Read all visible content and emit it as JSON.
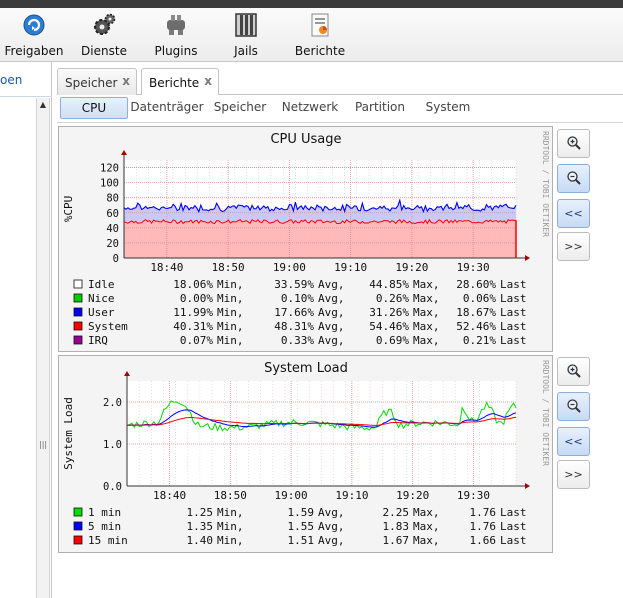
{
  "toolbar": {
    "items": [
      {
        "label": "Freigaben",
        "icon": "share-icon"
      },
      {
        "label": "Dienste",
        "icon": "gears-icon"
      },
      {
        "label": "Plugins",
        "icon": "plugin-icon"
      },
      {
        "label": "Jails",
        "icon": "jail-bars-icon"
      },
      {
        "label": "Berichte",
        "icon": "report-icon"
      }
    ]
  },
  "left_panel": {
    "link_fragment": "oen"
  },
  "tabs": [
    {
      "label": "Speicher",
      "close": "x",
      "active": false
    },
    {
      "label": "Berichte",
      "close": "x",
      "active": true
    }
  ],
  "subtabs": [
    {
      "label": "CPU",
      "active": true
    },
    {
      "label": "Datenträger",
      "active": false
    },
    {
      "label": "Speicher",
      "active": false
    },
    {
      "label": "Netzwerk",
      "active": false
    },
    {
      "label": "Partition",
      "active": false
    },
    {
      "label": "System",
      "active": false
    }
  ],
  "zoom_buttons": {
    "zoom_in": "zoom-in-icon",
    "zoom_out": "zoom-out-icon",
    "prev": "<<",
    "next": ">>"
  },
  "colors": {
    "idle": "#ffffff",
    "nice": "#00cc00",
    "user": "#0000ff",
    "system": "#ff0000",
    "irq": "#990099",
    "load1": "#00dd00",
    "load5": "#0000ff",
    "load15": "#ff0000"
  },
  "chart_data": [
    {
      "type": "area",
      "title": "CPU Usage",
      "ylabel": "%CPU",
      "watermark": "RRDTOOL / TOBI OETIKER",
      "ylim": [
        0,
        130
      ],
      "yticks": [
        0,
        20,
        40,
        60,
        80,
        100,
        120
      ],
      "xticks": [
        "18:40",
        "18:50",
        "19:00",
        "19:10",
        "19:20",
        "19:30"
      ],
      "x_range_minutes": [
        "18:33",
        "19:37"
      ],
      "series": [
        {
          "name": "Idle",
          "min": 18.06,
          "avg": 33.59,
          "max": 44.85,
          "last": 28.6
        },
        {
          "name": "Nice",
          "min": 0.0,
          "avg": 0.1,
          "max": 0.26,
          "last": 0.06
        },
        {
          "name": "User",
          "min": 11.99,
          "avg": 17.66,
          "max": 31.26,
          "last": 18.67
        },
        {
          "name": "System",
          "min": 40.31,
          "avg": 48.31,
          "max": 54.46,
          "last": 52.46
        },
        {
          "name": "IRQ",
          "min": 0.07,
          "avg": 0.33,
          "max": 0.69,
          "last": 0.21
        }
      ],
      "legend": [
        {
          "name": "Idle",
          "color": "#ffffff",
          "min": "18.06%",
          "avg": "33.59%",
          "max": "44.85%",
          "last": "28.60%"
        },
        {
          "name": "Nice",
          "color": "#00cc00",
          "min": "0.00%",
          "avg": "0.10%",
          "max": "0.26%",
          "last": "0.06%"
        },
        {
          "name": "User",
          "color": "#0000ff",
          "min": "11.99%",
          "avg": "17.66%",
          "max": "31.26%",
          "last": "18.67%"
        },
        {
          "name": "System",
          "color": "#ff0000",
          "min": "40.31%",
          "avg": "48.31%",
          "max": "54.46%",
          "last": "52.46%"
        },
        {
          "name": "IRQ",
          "color": "#990099",
          "min": "0.07%",
          "avg": "0.33%",
          "max": "0.69%",
          "last": "0.21%"
        }
      ],
      "legend_words": {
        "min": "Min,",
        "avg": "Avg,",
        "max": "Max,",
        "last": "Last"
      }
    },
    {
      "type": "line",
      "title": "System Load",
      "ylabel": "System Load",
      "watermark": "RRDTOOL / TOBI OETIKER",
      "ylim": [
        0,
        2.5
      ],
      "yticks": [
        "0.0",
        "1.0",
        "2.0"
      ],
      "xticks": [
        "18:40",
        "18:50",
        "19:00",
        "19:10",
        "19:20",
        "19:30"
      ],
      "series": [
        {
          "name": "1 min",
          "min": 1.25,
          "avg": 1.59,
          "max": 2.25,
          "last": 1.76
        },
        {
          "name": "5 min",
          "min": 1.35,
          "avg": 1.55,
          "max": 1.83,
          "last": 1.76
        },
        {
          "name": "15 min",
          "min": 1.4,
          "avg": 1.51,
          "max": 1.67,
          "last": 1.66
        }
      ],
      "legend": [
        {
          "name": "1 min",
          "color": "#00dd00",
          "min": "1.25",
          "avg": "1.59",
          "max": "2.25",
          "last": "1.76"
        },
        {
          "name": "5 min",
          "color": "#0000ff",
          "min": "1.35",
          "avg": "1.55",
          "max": "1.83",
          "last": "1.76"
        },
        {
          "name": "15 min",
          "color": "#ff0000",
          "min": "1.40",
          "avg": "1.51",
          "max": "1.67",
          "last": "1.66"
        }
      ],
      "legend_words": {
        "min": "Min,",
        "avg": "Avg,",
        "max": "Max,",
        "last": "Last"
      }
    }
  ]
}
